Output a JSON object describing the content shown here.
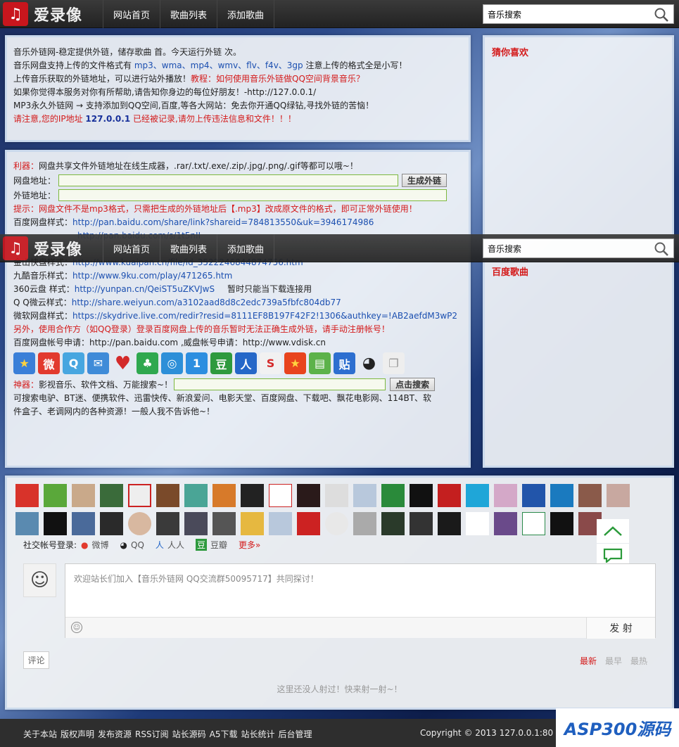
{
  "header": {
    "logo_text": "爱录像",
    "nav": [
      "网站首页",
      "歌曲列表",
      "添加歌曲"
    ],
    "search_value": "音乐搜索"
  },
  "notice": {
    "line1": "音乐外链网-稳定提供外链，储存歌曲 首。今天运行外链 次。",
    "line2_pre": "音乐网盘支持上传的文件格式有 ",
    "line2_formats": "mp3、wma、mp4、wmv、flv、f4v、3gp",
    "line2_post": " 注意上传的格式全是小写！",
    "line3_pre": "上传音乐获取的外链地址，可以进行站外播放！",
    "line3_link": "教程：如何使用音乐外链做QQ空间背景音乐？",
    "line4": "如果你觉得本服务对你有所帮助,请告知你身边的每位好朋友！-http://127.0.0.1/",
    "line5": "MP3永久外链网 → 支持添加到QQ空间,百度,等各大网站：免去你开通QQ绿钻,寻找外链的苦恼！",
    "line6_pre": "请注意,您的IP地址 ",
    "line6_ip": "127.0.0.1",
    "line6_post": " 已经被记录,请勿上传违法信息和文件！！！"
  },
  "tool": {
    "intro_label": "利器：",
    "intro_text": "网盘共享文件外链地址在线生成器，.rar/.txt/.exe/.zip/.jpg/.png/.gif等都可以哦~！",
    "pan_label": "网盘地址：",
    "out_label": "外链地址：",
    "generate_btn": "生成外链",
    "tip": "提示：网盘文件不是mp3格式，只需把生成的外链地址后【.mp3】改成原文件的格式，即可正常外链使用！",
    "samples": [
      {
        "label": "百度网盘样式：",
        "url": "http://pan.baidu.com/share/link?shareid=784813550&uk=3946174986"
      },
      {
        "label": "",
        "url": "http://pan.baidu.com/s/1t5nII"
      },
      {
        "label": "金山快盘样式：",
        "url": "http://www.kuaipan.cn/file/id_3522246844874756.htm"
      },
      {
        "label": "九酷音乐样式：",
        "url": "http://www.9ku.com/play/471265.htm"
      },
      {
        "label": "360云盘 样式：",
        "url": "http://yunpan.cn/QeiST5uZKVJwS",
        "note": "暂时只能当下载连接用"
      },
      {
        "label": "Q Q微云样式：",
        "url": "http://share.weiyun.com/a3102aad8d8c2edc739a5fbfc804db77"
      },
      {
        "label": "微软网盘样式：",
        "url": "https://skydrive.live.com/redir?resid=8111EF8B197F42F2!1306&authkey=!AB2aefdM3wP2"
      }
    ],
    "warning": "另外，使用合作方（如QQ登录）登录百度网盘上传的音乐暂时无法正确生成外链，请手动注册帐号！",
    "apply": "百度网盘帐号申请：http://pan.baidu.com ,威盘帐号申请：http://www.vdisk.cn",
    "search_label": "神器：",
    "search_text": "影视音乐、软件文档、万能搜索~！",
    "search_btn": "点击搜索",
    "desc1": "可搜索电驴、BT迷、便携软件、迅雷快传、新浪爱问、电影天堂、百度网盘、下载吧、飘花电影网、114BT、软",
    "desc2": "件盒子、老调网内的各种资源！一般人我不告诉他~！"
  },
  "sidebar": {
    "guess_title": "猜你喜欢",
    "baidu_title": "百度歌曲"
  },
  "comments": {
    "social_label": "社交帐号登录:",
    "social": [
      "微博",
      "QQ",
      "人人",
      "豆瓣",
      "更多»"
    ],
    "placeholder": "欢迎站长们加入【音乐外链网 QQ交流群50095717】共同探讨！",
    "send_btn": "发 射",
    "tag": "评论",
    "sort": [
      "最新",
      "最早",
      "最热"
    ],
    "empty": "这里还没人射过！快来射一射~！"
  },
  "footer": {
    "links": [
      "关于本站",
      "版权声明",
      "发布资源",
      "RSS订阅",
      "站长源码",
      "A5下载",
      "站长统计",
      "后台管理"
    ],
    "copyright": "Copyright © 2013  127.0.0.1:80",
    "watermark": "ASP300源码"
  }
}
